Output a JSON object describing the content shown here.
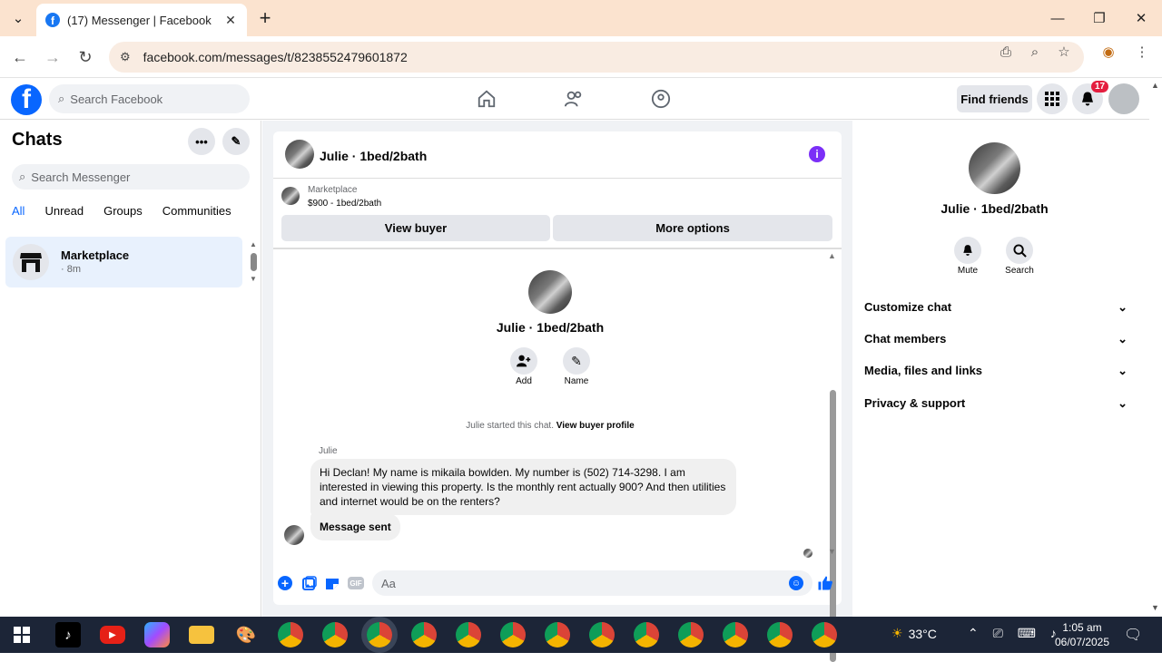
{
  "browser": {
    "tab_title": "(17) Messenger | Facebook",
    "url": "facebook.com/messages/t/8238552479601872"
  },
  "fb_header": {
    "search_placeholder": "Search Facebook",
    "find_friends": "Find friends",
    "notification_count": "17"
  },
  "left_panel": {
    "title": "Chats",
    "search_placeholder": "Search Messenger",
    "filters": [
      "All",
      "Unread",
      "Groups",
      "Communities"
    ],
    "active_filter": "All",
    "chat_item": {
      "name": "Marketplace",
      "time": "· 8m"
    }
  },
  "conversation": {
    "header_name": "Julie · 1bed/2bath",
    "marketplace_label": "Marketplace",
    "marketplace_price": "$900 - 1bed/2bath",
    "view_buyer": "View buyer",
    "more_options": "More options",
    "profile_name": "Julie · 1bed/2bath",
    "add_label": "Add",
    "name_label": "Name",
    "started_text": "Julie started this chat.",
    "view_buyer_profile": "View buyer profile",
    "sender": "Julie",
    "message_1": "Hi Declan! My name is mikaila bowlden. My number is (502) 714-3298. I am interested in viewing this property. Is the monthly rent actually 900? And then utilities and internet would be on the renters?",
    "message_2": "Message sent",
    "composer_placeholder": "Aa",
    "accent_color": "#0866ff"
  },
  "right_panel": {
    "name": "Julie · 1bed/2bath",
    "mute_label": "Mute",
    "search_label": "Search",
    "sections": [
      "Customize chat",
      "Chat members",
      "Media, files and links",
      "Privacy & support"
    ]
  },
  "taskbar": {
    "temperature": "33°C",
    "time": "1:05 am",
    "date": "06/07/2025"
  }
}
